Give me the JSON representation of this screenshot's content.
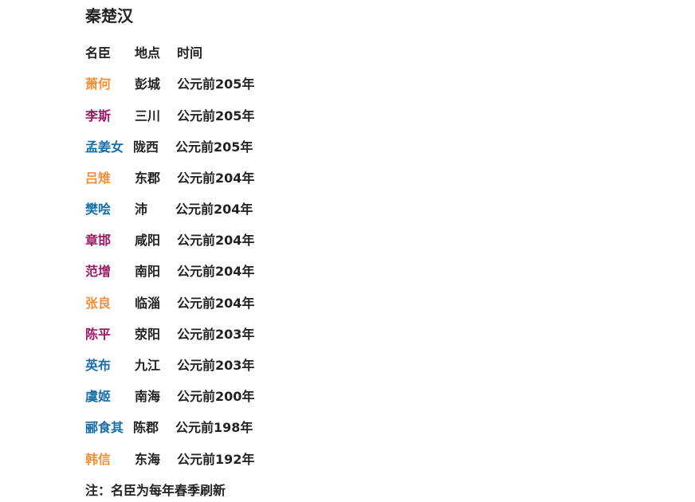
{
  "title": "秦楚汉",
  "headers": {
    "name": "名臣",
    "place": "地点",
    "time": "时间"
  },
  "colors": {
    "orange": "#f0903a",
    "purple": "#9b1a66",
    "blue": "#1a6fa6"
  },
  "rows": [
    {
      "name": "萧何",
      "place": "彭城",
      "time": "公元前205年",
      "color": "orange"
    },
    {
      "name": "李斯",
      "place": "三川",
      "time": "公元前205年",
      "color": "purple"
    },
    {
      "name": "孟姜女",
      "place": "陇西",
      "time": "公元前205年",
      "color": "blue"
    },
    {
      "name": "吕雉",
      "place": "东郡",
      "time": "公元前204年",
      "color": "orange"
    },
    {
      "name": "樊哙",
      "place": "沛",
      "time": "公元前204年",
      "color": "blue"
    },
    {
      "name": "章邯",
      "place": "咸阳",
      "time": "公元前204年",
      "color": "purple"
    },
    {
      "name": "范增",
      "place": "南阳",
      "time": "公元前204年",
      "color": "purple"
    },
    {
      "name": "张良",
      "place": "临淄",
      "time": "公元前204年",
      "color": "orange"
    },
    {
      "name": "陈平",
      "place": "荥阳",
      "time": "公元前203年",
      "color": "purple"
    },
    {
      "name": "英布",
      "place": "九江",
      "time": "公元前203年",
      "color": "blue"
    },
    {
      "name": "虞姬",
      "place": "南海",
      "time": "公元前200年",
      "color": "blue"
    },
    {
      "name": "郦食其",
      "place": "陈郡",
      "time": "公元前198年",
      "color": "blue"
    },
    {
      "name": "韩信",
      "place": "东海",
      "time": "公元前192年",
      "color": "orange"
    }
  ],
  "footnote": "注：名臣为每年春季刷新"
}
